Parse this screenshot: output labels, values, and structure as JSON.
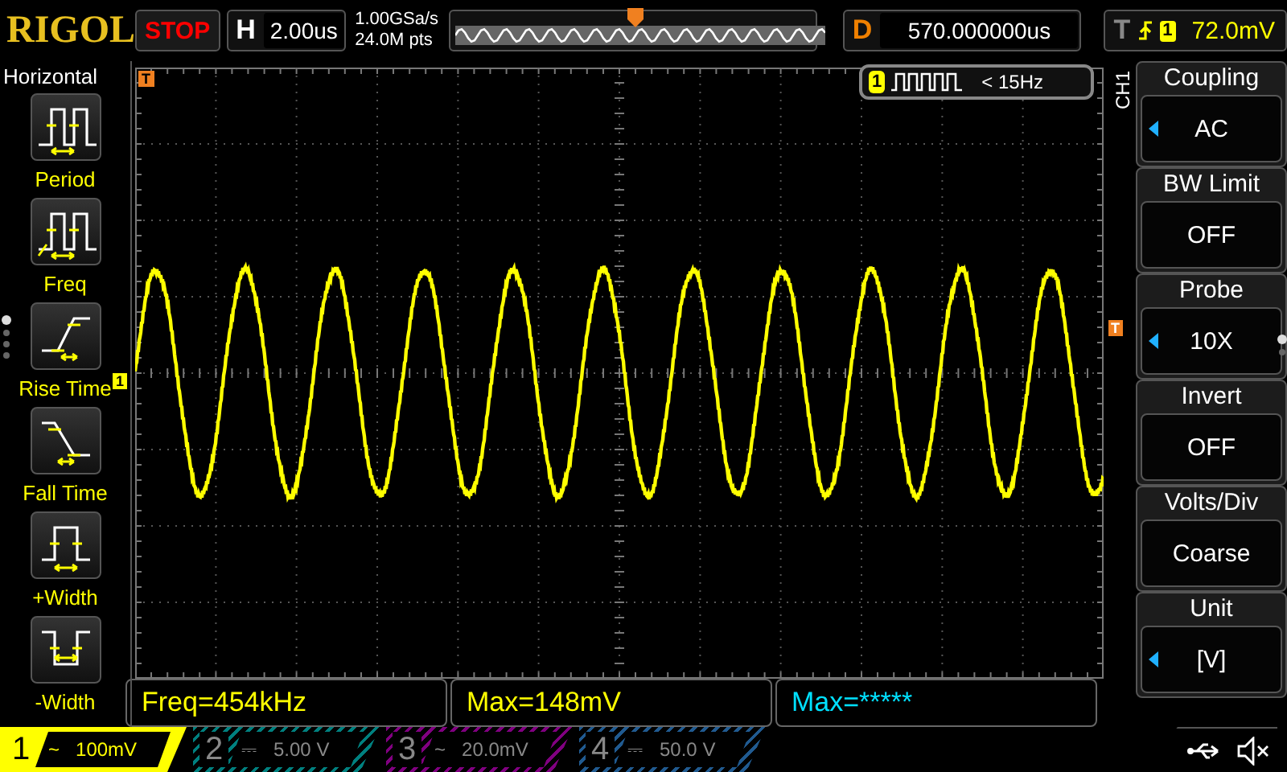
{
  "top_bar": {
    "logo": "RIGOL",
    "run_state": "STOP",
    "timebase": {
      "label": "H",
      "value": "2.00us"
    },
    "sample_rate": "1.00GSa/s",
    "memory_depth": "24.0M pts",
    "delay": {
      "label": "D",
      "value": "570.000000us"
    },
    "trigger": {
      "label": "T",
      "source": "1",
      "level": "72.0mV"
    }
  },
  "left_menu": {
    "title": "Horizontal",
    "items": [
      {
        "label": "Period",
        "kind": "period"
      },
      {
        "label": "Freq",
        "kind": "freq"
      },
      {
        "label": "Rise Time",
        "kind": "rise"
      },
      {
        "label": "Fall Time",
        "kind": "fall"
      },
      {
        "label": "+Width",
        "kind": "pwidth"
      },
      {
        "label": "-Width",
        "kind": "nwidth"
      }
    ],
    "pages": [
      {
        "selected": true
      },
      {
        "selected": false
      },
      {
        "selected": false
      },
      {
        "selected": false
      }
    ]
  },
  "display": {
    "channel_marker": "1",
    "trigger_marker": "T",
    "level_marker": "T",
    "counter": {
      "channel": "1",
      "reading": "< 15Hz"
    }
  },
  "right_menu": {
    "channel_label": "CH1",
    "items": [
      {
        "title": "Coupling",
        "value": "AC",
        "adjustable": true
      },
      {
        "title": "BW Limit",
        "value": "OFF",
        "adjustable": false
      },
      {
        "title": "Probe",
        "value": "10X",
        "adjustable": true
      },
      {
        "title": "Invert",
        "value": "OFF",
        "adjustable": false
      },
      {
        "title": "Volts/Div",
        "value": "Coarse",
        "adjustable": false
      },
      {
        "title": "Unit",
        "value": "[V]",
        "adjustable": true
      }
    ],
    "pages": [
      {
        "selected": true
      },
      {
        "selected": false
      }
    ]
  },
  "measurements": [
    {
      "text": "Freq=454kHz",
      "color": "#ffff00"
    },
    {
      "text": "Max=148mV",
      "color": "#ffff00"
    },
    {
      "text": "Max=*****",
      "color": "#00e0ff"
    }
  ],
  "channels": [
    {
      "number": "1",
      "coupling": "~",
      "scale": "100mV",
      "selected": true,
      "color": "#ffff00"
    },
    {
      "number": "2",
      "coupling": "⎓",
      "scale": "5.00 V",
      "selected": false,
      "color": "#00807f"
    },
    {
      "number": "3",
      "coupling": "~",
      "scale": "20.0mV",
      "selected": false,
      "color": "#800080"
    },
    {
      "number": "4",
      "coupling": "⎓",
      "scale": "50.0 V",
      "selected": false,
      "color": "#205a90"
    }
  ]
}
